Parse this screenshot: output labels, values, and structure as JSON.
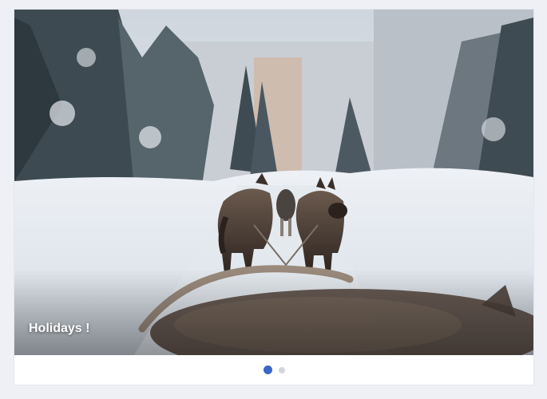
{
  "carousel": {
    "slides": [
      {
        "caption": "Holidays !",
        "image": "sled-dogs-snowy-forest-photo"
      }
    ],
    "pagination": {
      "count": 2,
      "active_index": 0
    },
    "colors": {
      "active_dot": "#3b66c4",
      "inactive_dot": "#d3d6dc",
      "page_bg": "#eef0f5"
    }
  }
}
